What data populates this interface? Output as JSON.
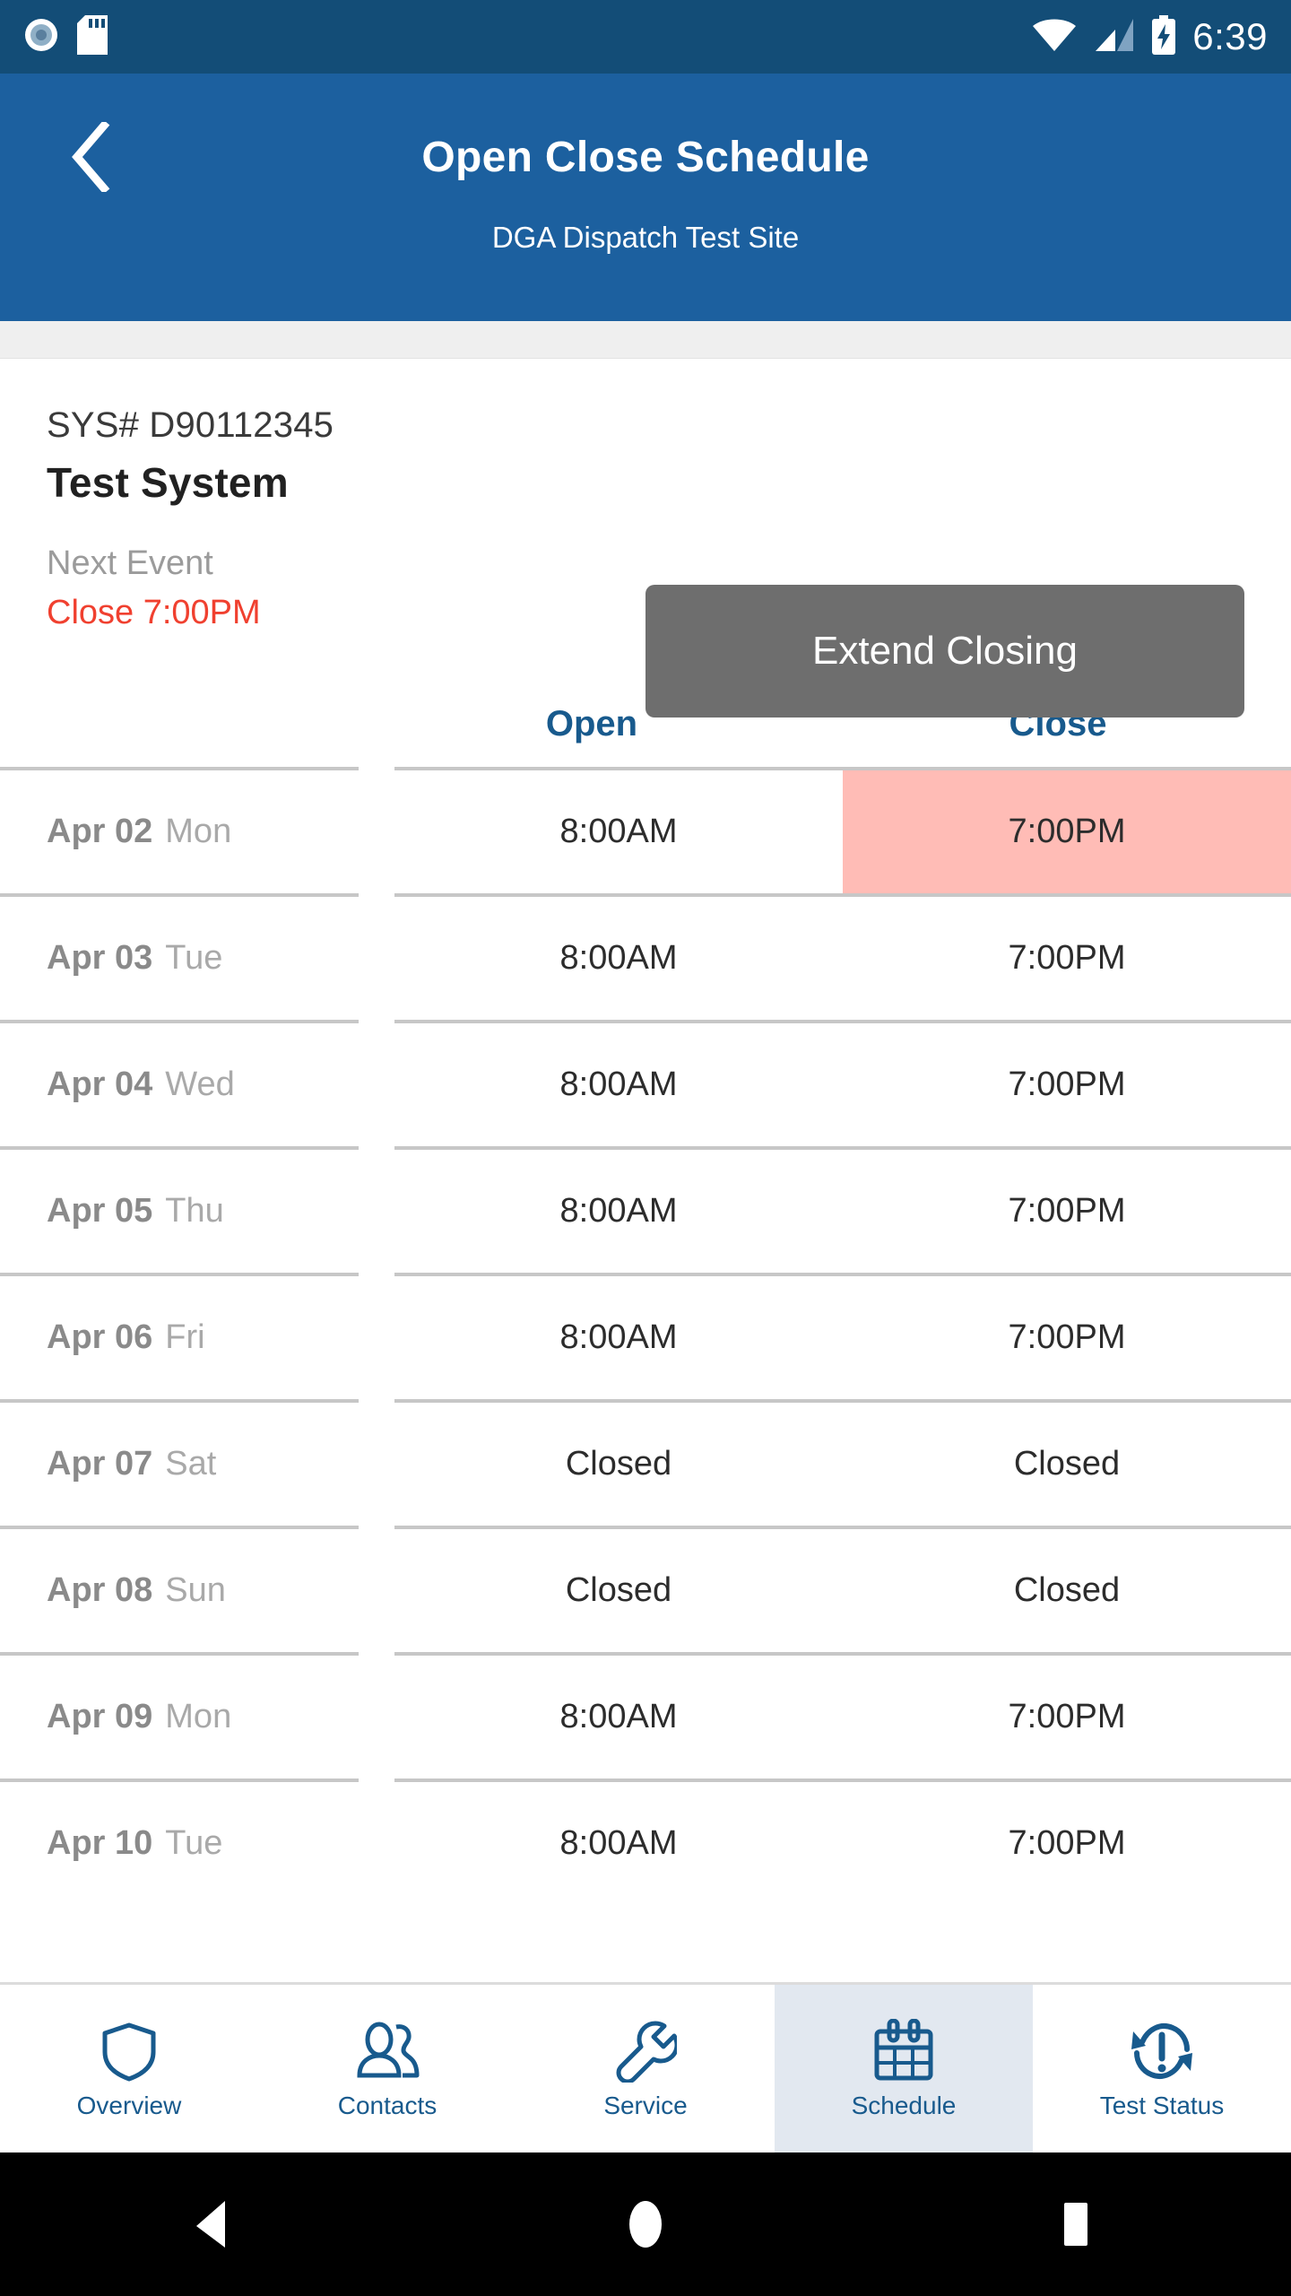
{
  "status_bar": {
    "time": "6:39",
    "icons_left": [
      "record-circle-icon",
      "sd-card-icon"
    ],
    "icons_right": [
      "wifi-icon",
      "cellular-signal-icon",
      "battery-charging-icon"
    ]
  },
  "header": {
    "back_icon": "back-chevron-icon",
    "title": "Open Close Schedule",
    "subtitle": "DGA Dispatch Test Site",
    "background_color": "#1C609F",
    "status_bar_color": "#134D77"
  },
  "system": {
    "sys_label": "SYS# D90112345",
    "name": "Test System",
    "next_event_label": "Next Event",
    "next_event_value": "Close 7:00PM",
    "next_event_color": "#F0402F"
  },
  "extend_button": {
    "label": "Extend Closing",
    "background_color": "#6E6E6E"
  },
  "schedule": {
    "columns": [
      "",
      "Open",
      "Close"
    ],
    "header_color": "#185A8D",
    "highlight_color": "#FFBCB6",
    "rows": [
      {
        "date": "Apr 02",
        "dow": "Mon",
        "open": "8:00AM",
        "close": "7:00PM",
        "close_highlighted": true
      },
      {
        "date": "Apr 03",
        "dow": "Tue",
        "open": "8:00AM",
        "close": "7:00PM",
        "close_highlighted": false
      },
      {
        "date": "Apr 04",
        "dow": "Wed",
        "open": "8:00AM",
        "close": "7:00PM",
        "close_highlighted": false
      },
      {
        "date": "Apr 05",
        "dow": "Thu",
        "open": "8:00AM",
        "close": "7:00PM",
        "close_highlighted": false
      },
      {
        "date": "Apr 06",
        "dow": "Fri",
        "open": "8:00AM",
        "close": "7:00PM",
        "close_highlighted": false
      },
      {
        "date": "Apr 07",
        "dow": "Sat",
        "open": "Closed",
        "close": "Closed",
        "close_highlighted": false
      },
      {
        "date": "Apr 08",
        "dow": "Sun",
        "open": "Closed",
        "close": "Closed",
        "close_highlighted": false
      },
      {
        "date": "Apr 09",
        "dow": "Mon",
        "open": "8:00AM",
        "close": "7:00PM",
        "close_highlighted": false
      },
      {
        "date": "Apr 10",
        "dow": "Tue",
        "open": "8:00AM",
        "close": "7:00PM",
        "close_highlighted": false
      }
    ]
  },
  "tabbar": {
    "accent_color": "#185A8D",
    "selected_background": "#E2E8F0",
    "tabs": [
      {
        "label": "Overview",
        "icon": "shield-icon",
        "selected": false
      },
      {
        "label": "Contacts",
        "icon": "people-icon",
        "selected": false
      },
      {
        "label": "Service",
        "icon": "wrench-icon",
        "selected": false
      },
      {
        "label": "Schedule",
        "icon": "calendar-icon",
        "selected": true
      },
      {
        "label": "Test Status",
        "icon": "refresh-alert-icon",
        "selected": false
      }
    ]
  },
  "android_nav": {
    "back": "nav-back-triangle",
    "home": "nav-home-circle",
    "recents": "nav-recents-square"
  }
}
